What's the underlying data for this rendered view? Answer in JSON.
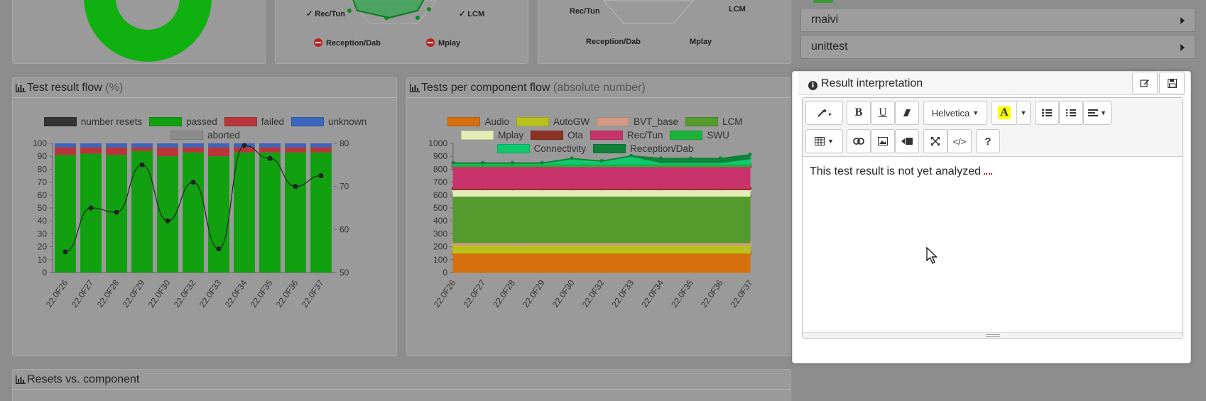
{
  "top_left_chart": {},
  "radar1": {
    "labels": [
      {
        "text": "Rec/Tun",
        "prefix": "✓"
      },
      {
        "text": "LCM",
        "prefix": "✓"
      },
      {
        "text": "Reception/Dab",
        "prefix": "minus"
      },
      {
        "text": "Mplay",
        "prefix": "minus"
      }
    ]
  },
  "radar2": {
    "labels": [
      "Rec/Tun",
      "LCM",
      "Reception/Dab",
      "Mplay"
    ]
  },
  "accordion": {
    "items": [
      {
        "label": "rnaivi"
      },
      {
        "label": "unittest"
      }
    ]
  },
  "panel_flow": {
    "title": "Test result flow",
    "subtitle": "(%)"
  },
  "panel_component": {
    "title": "Tests per component flow",
    "subtitle": "(absolute number)"
  },
  "panel_resets": {
    "title": "Resets vs. component"
  },
  "modal": {
    "title": "Result interpretation",
    "content": "This test result is not yet analyzed",
    "font_label": "Helvetica",
    "toolbar": {
      "bold": "B",
      "underline": "U",
      "code": "</>",
      "help": "?"
    }
  },
  "chart_data": [
    {
      "type": "bar",
      "stacked": true,
      "categories": [
        "22.0F26",
        "22.0F27",
        "22.0F28",
        "22.0F29",
        "22.0F30",
        "22.0F32",
        "22.0F33",
        "22.0F34",
        "22.0F35",
        "22.0F36",
        "22.0F37"
      ],
      "legend": [
        {
          "name": "number resets",
          "color": "#333333"
        },
        {
          "name": "passed",
          "color": "#10a010"
        },
        {
          "name": "failed",
          "color": "#b8363b"
        },
        {
          "name": "unknown",
          "color": "#3a66c0"
        },
        {
          "name": "aborted",
          "color": "#8c8c8c"
        }
      ],
      "series": [
        {
          "name": "passed",
          "values": [
            91,
            92,
            91,
            94,
            90,
            93,
            90,
            93,
            93,
            93,
            93
          ]
        },
        {
          "name": "failed",
          "values": [
            6,
            5,
            6,
            3,
            7,
            4,
            7,
            4,
            4,
            4,
            4
          ]
        },
        {
          "name": "unknown",
          "values": [
            3,
            3,
            3,
            3,
            3,
            3,
            3,
            3,
            3,
            3,
            3
          ]
        },
        {
          "name": "aborted",
          "values": [
            0,
            0,
            0,
            0,
            0,
            0,
            0,
            0,
            0,
            0,
            0
          ]
        },
        {
          "name": "number resets",
          "axis": "right",
          "values": [
            54.8,
            65,
            64,
            75,
            62,
            71,
            55.5,
            79.5,
            76.5,
            70,
            72.5
          ]
        }
      ],
      "ylim": [
        0,
        100
      ],
      "yticks": [
        0,
        10,
        20,
        30,
        40,
        50,
        60,
        70,
        80,
        90,
        100
      ],
      "y2lim": [
        50,
        80
      ],
      "y2ticks": [
        50,
        60,
        70,
        80
      ]
    },
    {
      "type": "area",
      "stacked": true,
      "categories": [
        "22.0F26",
        "22.0F27",
        "22.0F28",
        "22.0F29",
        "22.0F30",
        "22.0F32",
        "22.0F33",
        "22.0F34",
        "22.0F35",
        "22.0F36",
        "22.0F37"
      ],
      "legend": [
        {
          "name": "Audio",
          "color": "#d6700f"
        },
        {
          "name": "AutoGW",
          "color": "#b9c21a"
        },
        {
          "name": "BVT_base",
          "color": "#d29a86"
        },
        {
          "name": "LCM",
          "color": "#559a2c"
        },
        {
          "name": "Mplay",
          "color": "#e4edb8"
        },
        {
          "name": "Ota",
          "color": "#8a3123"
        },
        {
          "name": "Rec/Tun",
          "color": "#c8336b"
        },
        {
          "name": "SWU",
          "color": "#1db33a"
        },
        {
          "name": "Connectivity",
          "color": "#10c870"
        },
        {
          "name": "Reception/Dab",
          "color": "#10823a"
        }
      ],
      "series": [
        {
          "name": "Audio",
          "values": [
            150,
            150,
            150,
            150,
            150,
            150,
            150,
            150,
            150,
            150,
            150
          ]
        },
        {
          "name": "AutoGW",
          "values": [
            60,
            60,
            60,
            60,
            60,
            60,
            60,
            60,
            60,
            60,
            60
          ]
        },
        {
          "name": "BVT_base",
          "values": [
            20,
            20,
            20,
            20,
            20,
            20,
            20,
            20,
            20,
            20,
            20
          ]
        },
        {
          "name": "LCM",
          "values": [
            360,
            360,
            360,
            360,
            360,
            360,
            360,
            360,
            360,
            360,
            360
          ]
        },
        {
          "name": "Mplay",
          "values": [
            50,
            50,
            50,
            50,
            50,
            50,
            50,
            50,
            50,
            50,
            50
          ]
        },
        {
          "name": "Ota",
          "values": [
            10,
            10,
            10,
            10,
            10,
            10,
            10,
            10,
            10,
            10,
            10
          ]
        },
        {
          "name": "Rec/Tun",
          "values": [
            170,
            170,
            170,
            170,
            170,
            170,
            170,
            170,
            170,
            170,
            170
          ]
        },
        {
          "name": "SWU",
          "values": [
            20,
            20,
            20,
            20,
            20,
            20,
            20,
            20,
            20,
            20,
            20
          ]
        },
        {
          "name": "Connectivity",
          "values": [
            5,
            5,
            5,
            5,
            40,
            20,
            60,
            10,
            10,
            10,
            40
          ]
        },
        {
          "name": "Reception/Dab",
          "values": [
            5,
            5,
            5,
            5,
            5,
            5,
            5,
            35,
            35,
            35,
            35
          ]
        }
      ],
      "ylim": [
        0,
        1000
      ],
      "yticks": [
        0,
        100,
        200,
        300,
        400,
        500,
        600,
        700,
        800,
        900,
        1000
      ]
    }
  ]
}
